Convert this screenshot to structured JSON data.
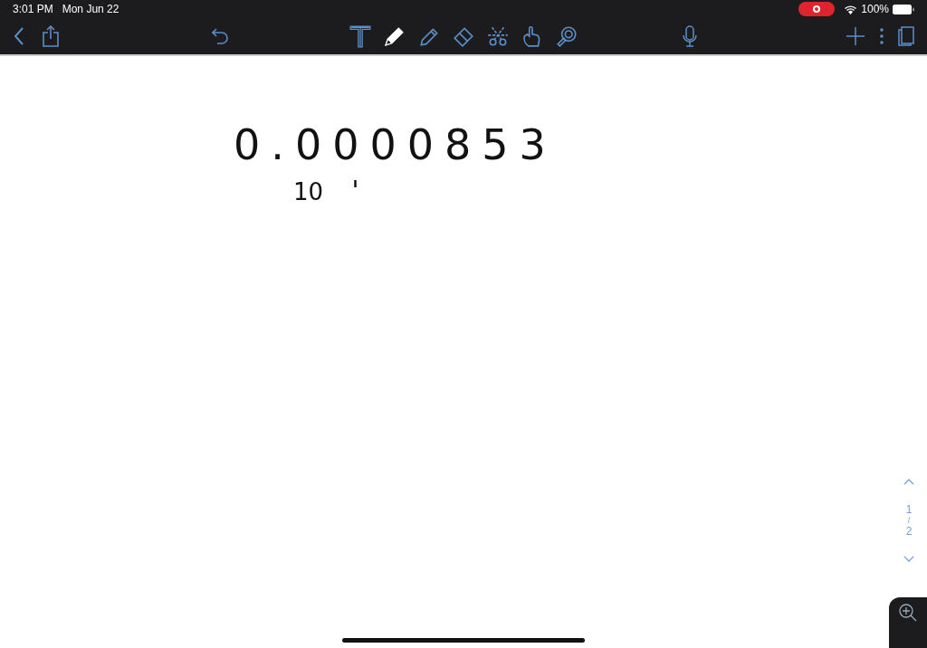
{
  "status_bar": {
    "time": "3:01 PM",
    "date": "Mon Jun 22",
    "recording": true,
    "battery": "100%"
  },
  "toolbar": {
    "tools": [
      {
        "kind": "text",
        "selected": false
      },
      {
        "kind": "pen",
        "selected": true
      },
      {
        "kind": "highlighter",
        "selected": false
      },
      {
        "kind": "eraser",
        "selected": false
      },
      {
        "kind": "scissors",
        "selected": false
      },
      {
        "kind": "hand",
        "selected": false
      },
      {
        "kind": "laser",
        "selected": false
      }
    ]
  },
  "canvas": {
    "lines": [
      "0.0000853",
      "10"
    ]
  },
  "page_indicator": {
    "current": "1",
    "separator": "/",
    "total": "2"
  }
}
